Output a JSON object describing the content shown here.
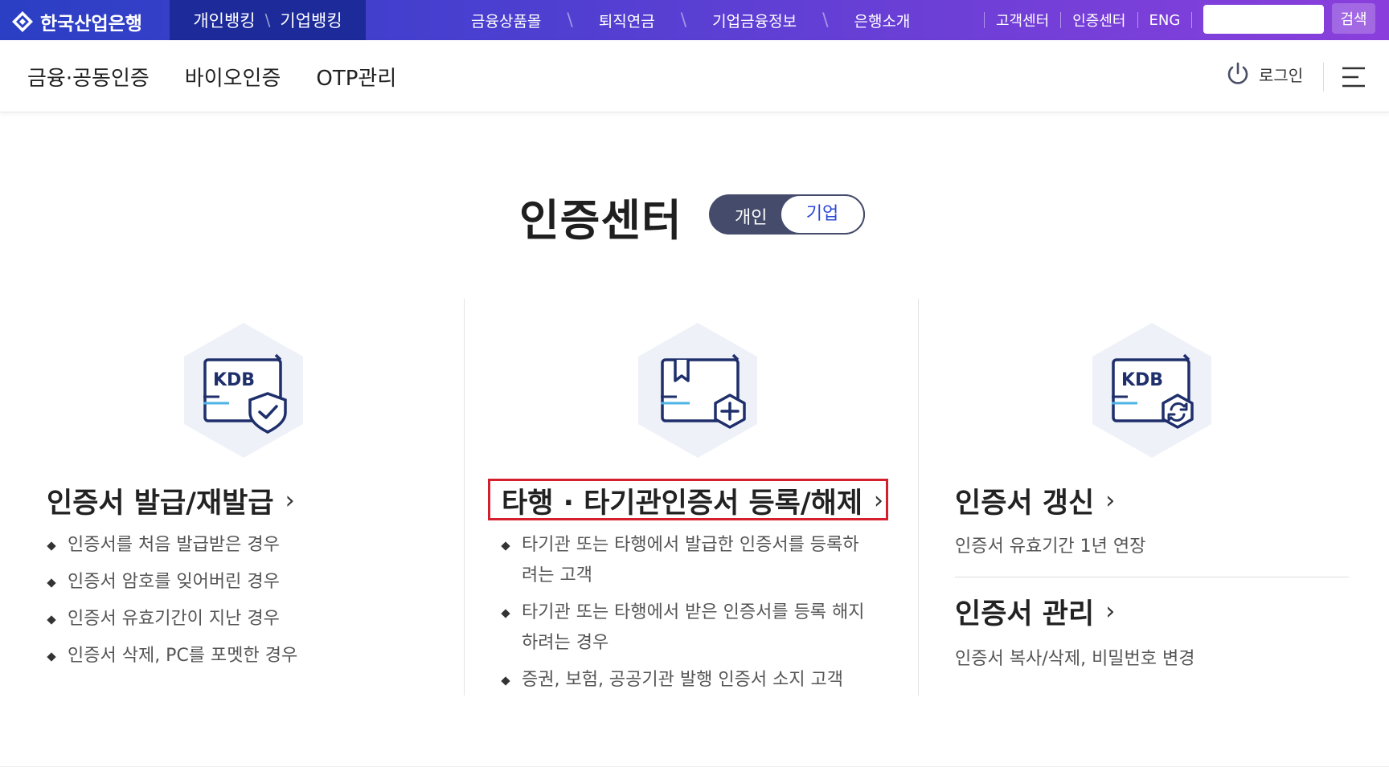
{
  "header": {
    "logo_text": "한국산업은행",
    "bank_tabs": [
      "개인뱅킹",
      "기업뱅킹"
    ],
    "bank_tab_sep": "\\",
    "nav": [
      "금융상품몰",
      "퇴직연금",
      "기업금융정보",
      "은행소개"
    ],
    "nav_sep": "\\",
    "util": [
      "고객센터",
      "인증센터",
      "ENG"
    ],
    "search_placeholder": "",
    "search_label": "검색"
  },
  "subnav": {
    "links": [
      "금융·공동인증",
      "바이오인증",
      "OTP관리"
    ],
    "login": "로그인"
  },
  "hero": {
    "title": "인증센터",
    "toggle": {
      "personal": "개인",
      "corporate": "기업",
      "selected": "corporate"
    }
  },
  "cards": {
    "issue": {
      "title": "인증서 발급/재발급",
      "bullets": [
        "인증서를 처음 발급받은 경우",
        "인증서 암호를 잊어버린 경우",
        "인증서 유효기간이 지난 경우",
        "인증서 삭제, PC를 포멧한 경우"
      ]
    },
    "register": {
      "title": "타행 · 타기관인증서 등록/해제",
      "bullets": [
        "타기관 또는 타행에서 발급한 인증서를 등록하려는 고객",
        "타기관 또는 타행에서 받은 인증서를 등록 해지하려는 경우",
        "증권, 보험, 공공기관 발행 인증서 소지 고객"
      ]
    },
    "renew": {
      "title": "인증서 갱신",
      "desc": "인증서 유효기간 1년 연장"
    },
    "manage": {
      "title": "인증서 관리",
      "desc": "인증서 복사/삭제, 비밀번호 변경"
    },
    "icon_badge": "KDB",
    "chevron": "›"
  },
  "colors": {
    "brand_dark": "#1c2a9a",
    "icon_navy": "#1e2f6b",
    "icon_bg": "#eef1f8",
    "highlight": "#d4202c",
    "toggle_bg": "#454b6b",
    "toggle_text": "#2d4ad8"
  },
  "icons": [
    "kdb-logo-icon",
    "power-icon",
    "hamburger-menu-icon",
    "certificate-shield-icon",
    "certificate-add-icon",
    "certificate-renew-icon"
  ]
}
